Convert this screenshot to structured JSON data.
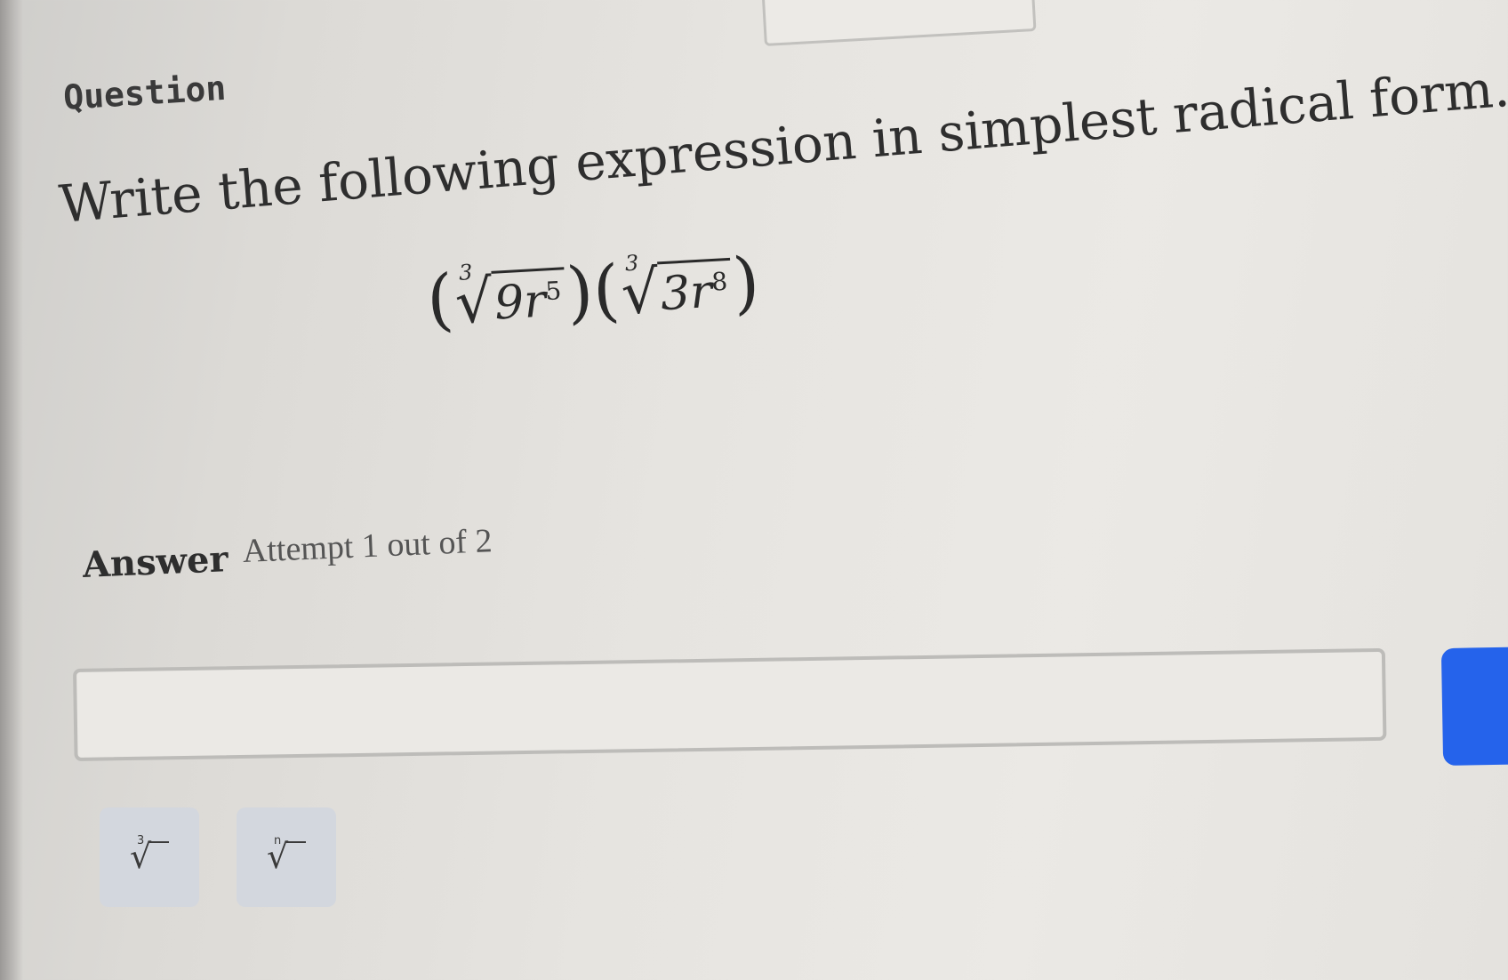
{
  "question": {
    "label": "Question",
    "prompt": "Write the following expression in simplest radical form."
  },
  "expression": {
    "factor1": {
      "index": "3",
      "coefficient": "9",
      "variable": "r",
      "exponent": "5"
    },
    "factor2": {
      "index": "3",
      "coefficient": "3",
      "variable": "r",
      "exponent": "8"
    }
  },
  "answer": {
    "label": "Answer",
    "attempt": "Attempt 1 out of 2",
    "input_value": ""
  },
  "toolbar": {
    "cube_root": {
      "icon": "cube-root-icon",
      "index": "3"
    },
    "nth_root": {
      "icon": "nth-root-icon",
      "index": "n"
    }
  },
  "colors": {
    "submit_button": "#2563eb",
    "tool_button": "#d3d7de"
  }
}
